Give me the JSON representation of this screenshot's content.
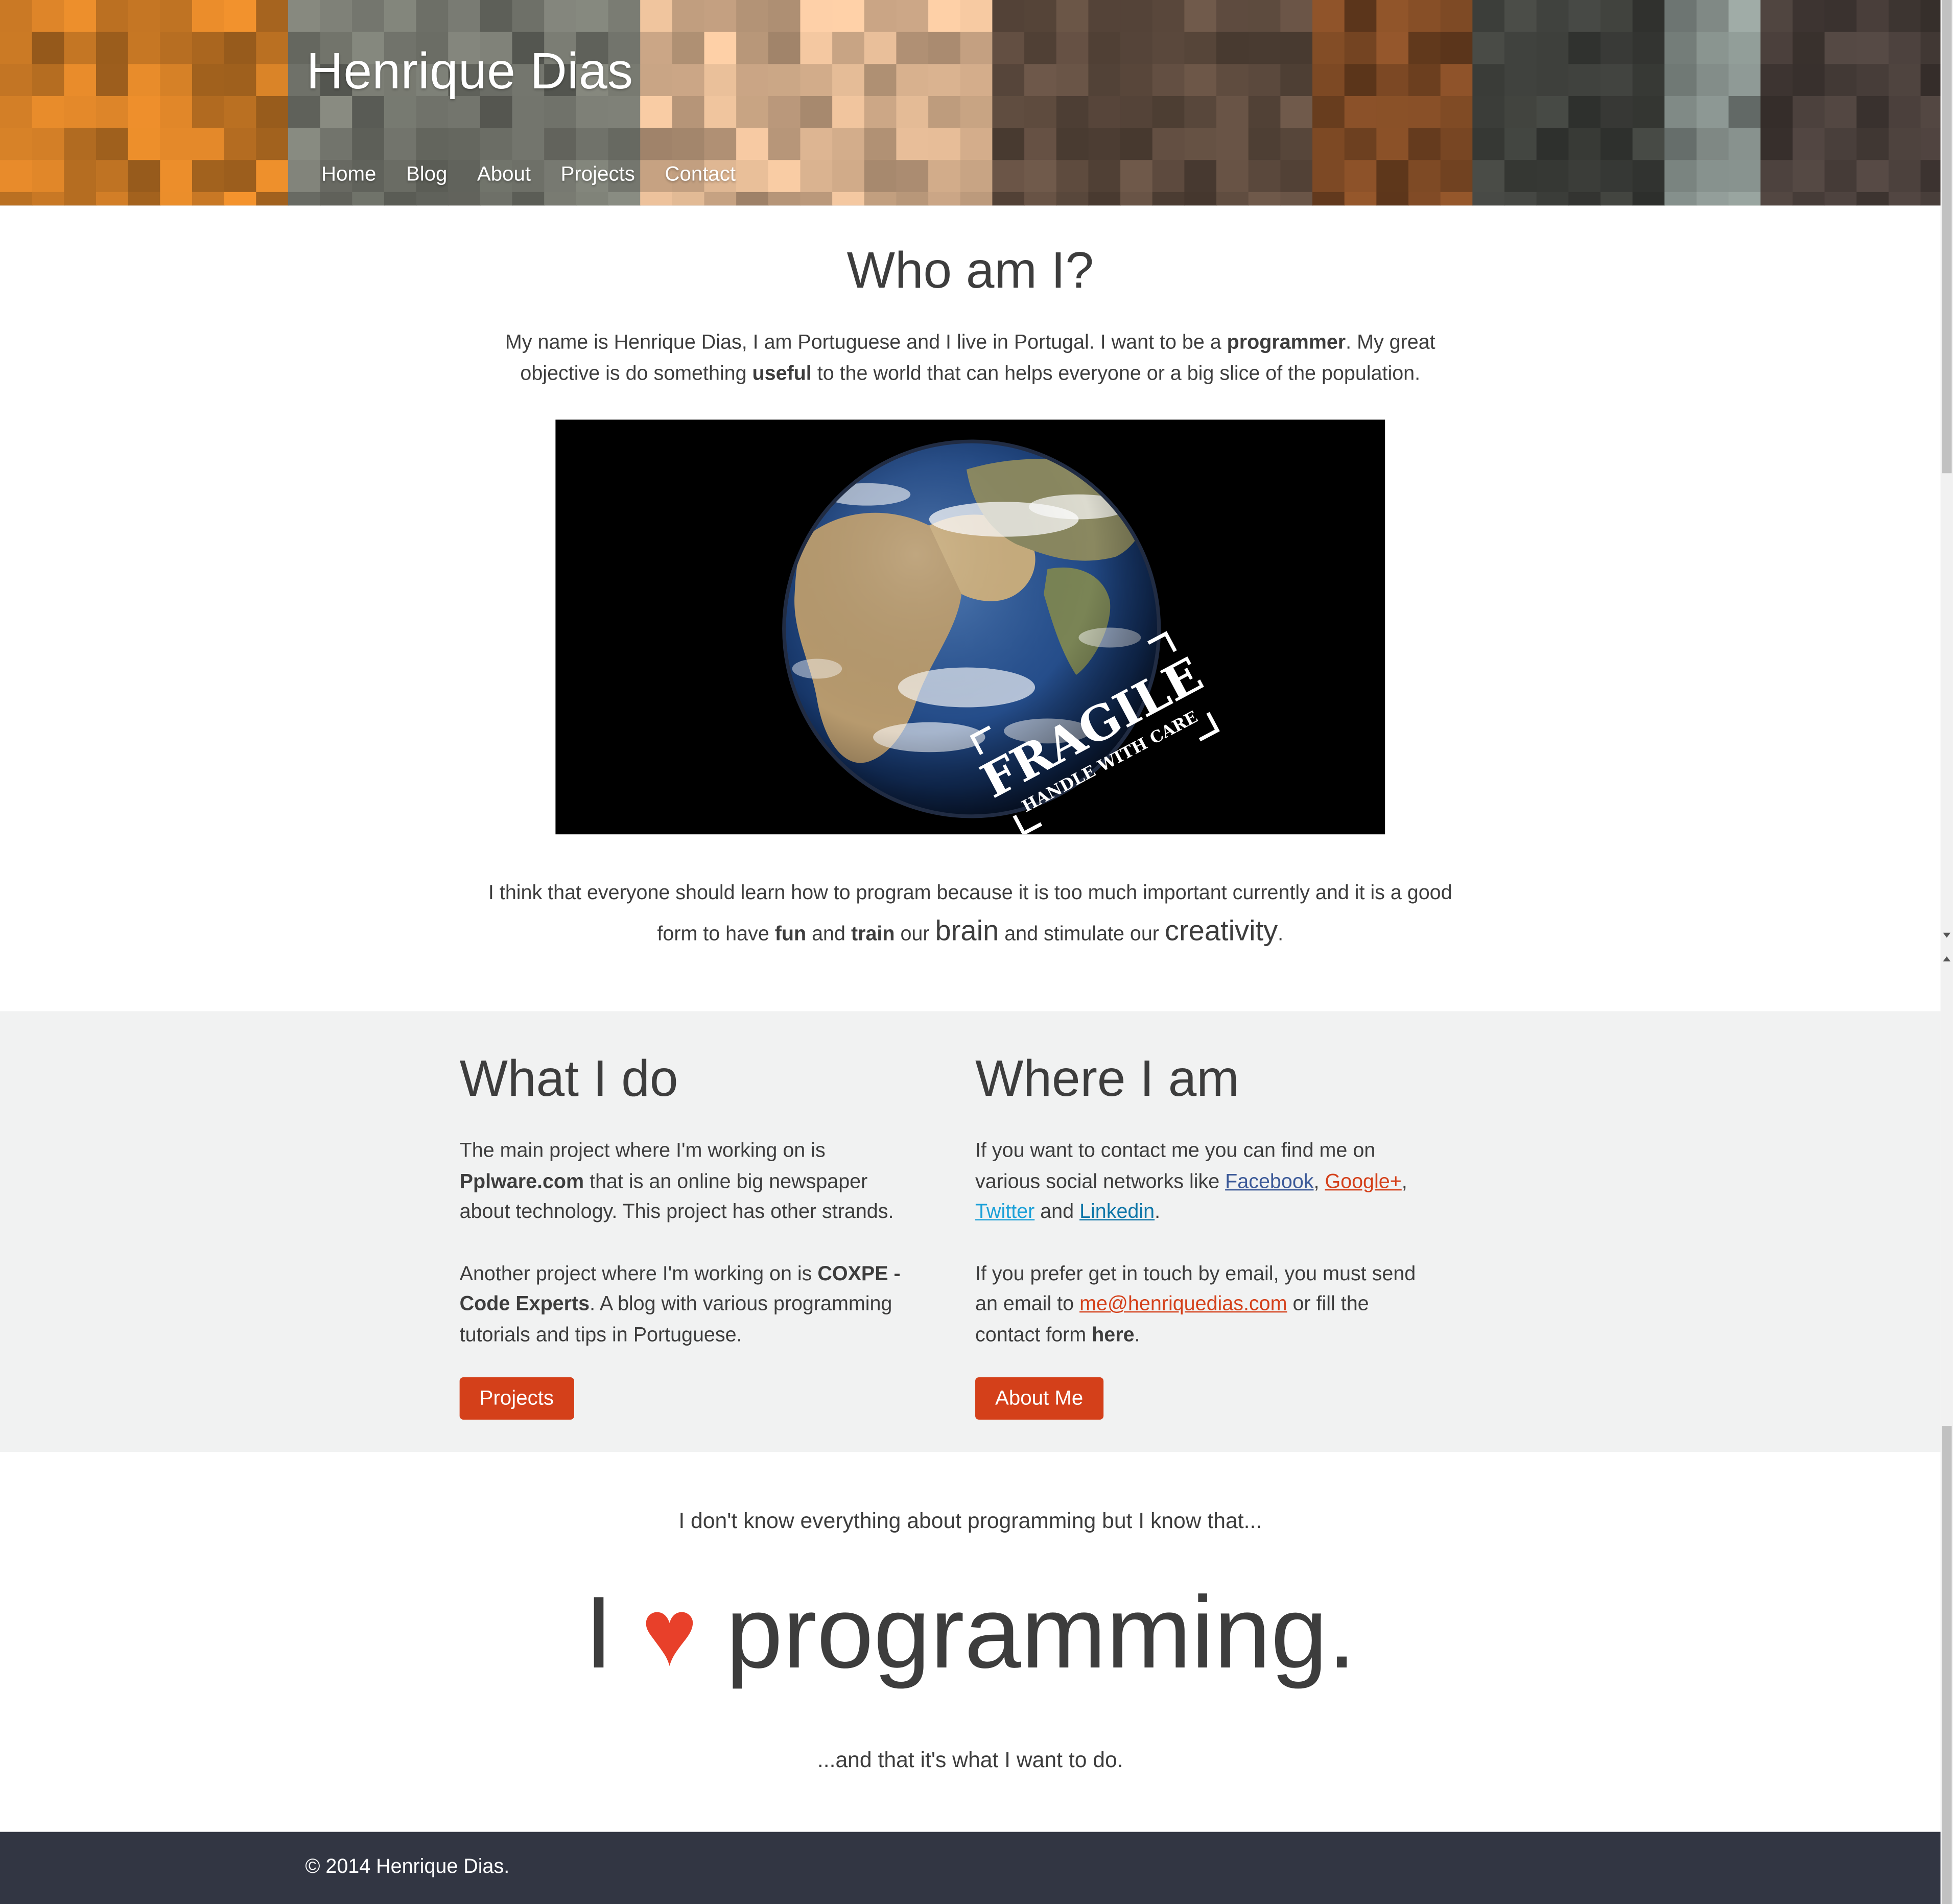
{
  "site": {
    "title": "Henrique Dias"
  },
  "nav": {
    "items": [
      "Home",
      "Blog",
      "About",
      "Projects",
      "Contact"
    ]
  },
  "intro": {
    "title": "Who am I?",
    "text_1": "My name is Henrique Dias, I am Portuguese and I live in Portugal. I want to be a ",
    "bold_1": "programmer",
    "text_2": ". My great objective is do something ",
    "bold_2": "useful",
    "text_3": " to the world that can helps everyone or a big slice of the population."
  },
  "image": {
    "stamp_main": "FRAGILE",
    "stamp_sub": "HANDLE WITH CARE"
  },
  "belief": {
    "t1": "I think that everyone should learn how to program because it is too much important currently and it is a good form to have ",
    "b1": "fun",
    "t2": " and ",
    "b2": "train",
    "t3": " our ",
    "big1": "brain",
    "t4": " and stimulate our ",
    "big2": "creativity",
    "t5": "."
  },
  "what_i_do": {
    "title": "What I do",
    "p1_t1": "The main project where I'm working on is ",
    "p1_b1": "Pplware.com",
    "p1_t2": " that is an online big newspaper about technology. This project has other strands.",
    "p2_t1": "Another project where I'm working on is ",
    "p2_b1": "COXPE - Code Experts",
    "p2_t2": ". A blog with various programming tutorials and tips in Portuguese.",
    "button": "Projects"
  },
  "where_i_am": {
    "title": "Where I am",
    "p1_t1": "If you want to contact me you can find me on various social networks like ",
    "facebook": "Facebook",
    "comma1": ", ",
    "googleplus": "Google+",
    "comma2": ", ",
    "twitter": "Twitter",
    "and": " and ",
    "linkedin": "Linkedin",
    "period": ".",
    "p2_t1": "If you prefer get in touch by email, you must send an email to ",
    "email": "me@henriquedias.com",
    "p2_t2": " or fill the contact form ",
    "p2_b1": "here",
    "p2_t3": ".",
    "button": "About Me"
  },
  "love": {
    "pre": "I don't know everything about programming but I know that...",
    "word_i": "I",
    "heart": "♥",
    "word_programming": "programming.",
    "post": "...and that it's what I want to do."
  },
  "footer": {
    "copyright": "© 2014 Henrique Dias."
  },
  "colors": {
    "accent": "#d4401a",
    "heart": "#e8402a",
    "footer_bg": "#323643",
    "section_bg": "#f1f2f2",
    "text": "#3d3d3d"
  }
}
